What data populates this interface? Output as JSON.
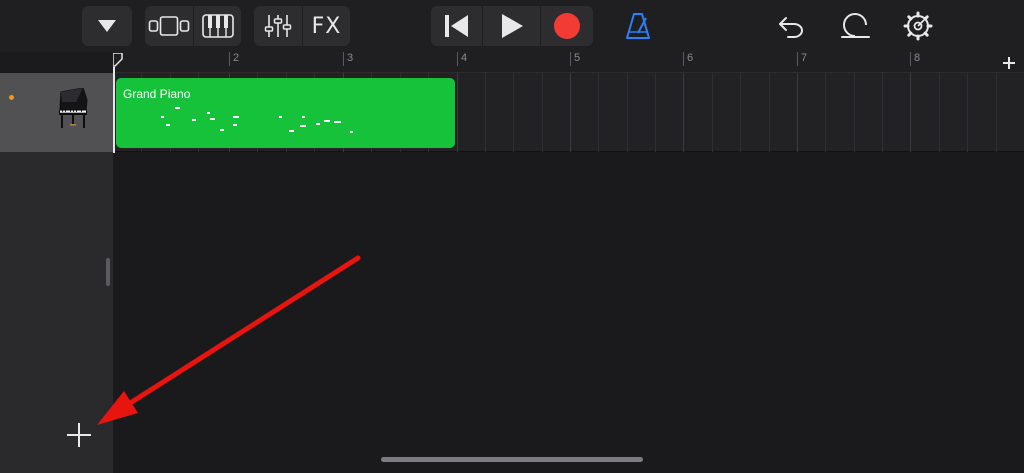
{
  "toolbar": {
    "fx_label": "FX"
  },
  "icons": {
    "view_menu": "triangle-down-icon",
    "tracks_view": "tracks-view-icon",
    "keyboard": "keyboard-icon",
    "mixer": "mixer-sliders-icon",
    "rewind": "rewind-icon",
    "play": "play-icon",
    "record": "record-icon",
    "metronome": "metronome-icon",
    "undo": "undo-icon",
    "loop_browser": "loop-icon",
    "settings": "gear-icon",
    "add_section": "plus-icon",
    "add_track": "plus-icon",
    "track_instrument": "grand-piano-icon"
  },
  "colors": {
    "record": "#f23b34",
    "metronome": "#2f7ff5",
    "region": "#15c23a",
    "track_dot": "#e39a2a",
    "annotation_arrow": "#e8140f"
  },
  "ruler": {
    "bars": [
      "2",
      "3",
      "4",
      "5",
      "6",
      "7",
      "8"
    ]
  },
  "track": {
    "region_name": "Grand Piano"
  }
}
